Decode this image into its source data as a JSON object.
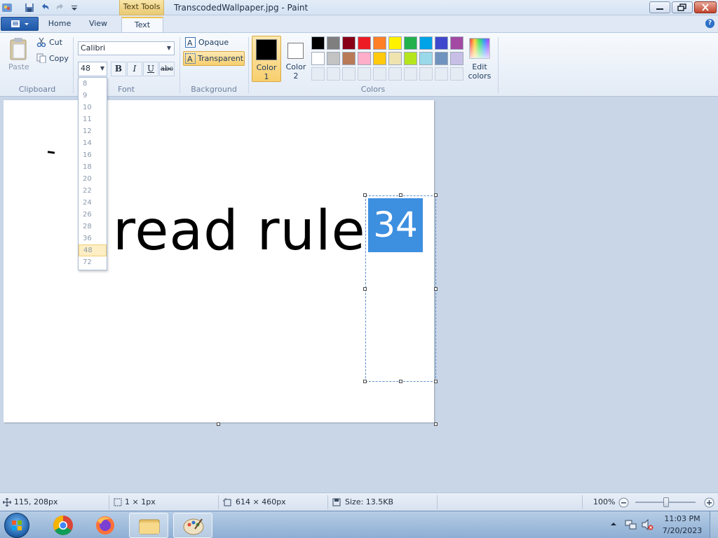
{
  "titlebar": {
    "title": "TranscodedWallpaper.jpg - Paint",
    "context_tab": "Text Tools"
  },
  "tabs": {
    "home": "Home",
    "view": "View",
    "text": "Text"
  },
  "clipboard": {
    "paste": "Paste",
    "cut": "Cut",
    "copy": "Copy",
    "label": "Clipboard"
  },
  "font": {
    "family": "Calibri",
    "size": "48",
    "bold": "B",
    "italic": "I",
    "underline": "U",
    "strike": "abc",
    "label": "Font",
    "size_options": [
      "8",
      "9",
      "10",
      "11",
      "12",
      "14",
      "16",
      "18",
      "20",
      "22",
      "24",
      "26",
      "28",
      "36",
      "48",
      "72"
    ],
    "hovered_size": "48"
  },
  "background": {
    "opaque": "Opaque",
    "transparent": "Transparent",
    "label": "Background"
  },
  "colors": {
    "color1_label": "Color",
    "color1_num": "1",
    "color2_label": "Color",
    "color2_num": "2",
    "edit_line1": "Edit",
    "edit_line2": "colors",
    "label": "Colors",
    "color1": "#000000",
    "color2": "#ffffff",
    "palette_row1": [
      "#000000",
      "#7f7f7f",
      "#880015",
      "#ed1c24",
      "#ff7f27",
      "#fff200",
      "#22b14c",
      "#00a2e8",
      "#3f48cc",
      "#a349a4"
    ],
    "palette_row2": [
      "#ffffff",
      "#c3c3c3",
      "#b97a57",
      "#ffaec9",
      "#ffc90e",
      "#efe4b0",
      "#b5e61d",
      "#99d9ea",
      "#7092be",
      "#c8bfe7"
    ]
  },
  "canvas": {
    "text": "read rule",
    "selected_text": "34"
  },
  "statusbar": {
    "cursor": "115, 208px",
    "selection": "1 × 1px",
    "dimensions": "614 × 460px",
    "size": "Size: 13.5KB",
    "zoom": "100%"
  },
  "taskbar": {
    "time": "11:03 PM",
    "date": "7/20/2023"
  }
}
